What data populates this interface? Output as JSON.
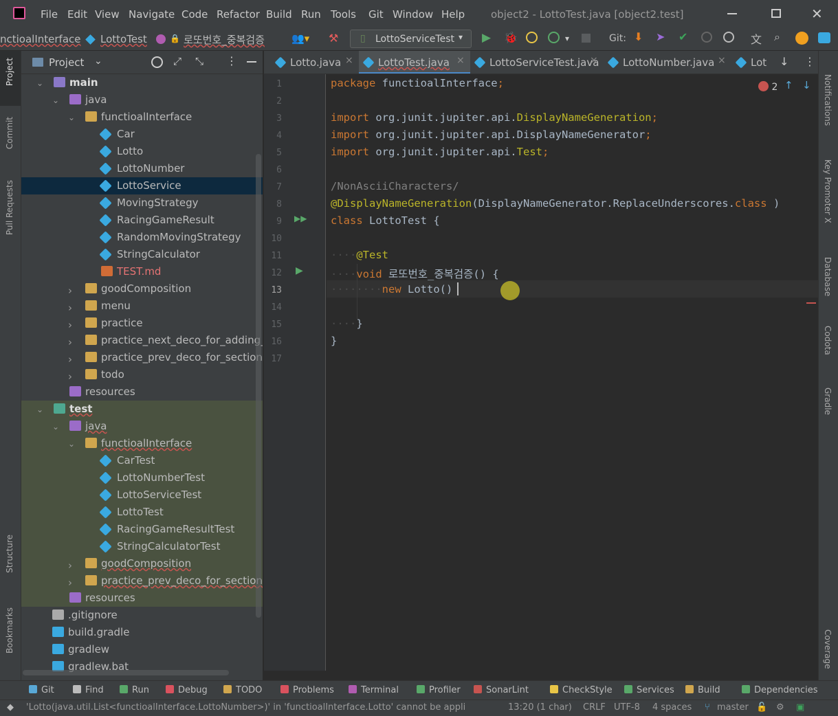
{
  "menu": [
    "File",
    "Edit",
    "View",
    "Navigate",
    "Code",
    "Refactor",
    "Build",
    "Run",
    "Tools",
    "Git",
    "Window",
    "Help"
  ],
  "window_title": "object2 - LottoTest.java [object2.test]",
  "breadcrumb": {
    "part1": "nctioalInterface",
    "sep": "›",
    "part2": "LottoTest",
    "part3": "로또번호_중복검증"
  },
  "run_config": "LottoServiceTest",
  "git_label": "Git:",
  "project_panel": {
    "title": "Project"
  },
  "tree": [
    {
      "label": "main",
      "depth": 0,
      "type": "module",
      "expanded": true,
      "bold": true
    },
    {
      "label": "java",
      "depth": 1,
      "type": "src",
      "expanded": true
    },
    {
      "label": "functioalInterface",
      "depth": 2,
      "type": "folder",
      "expanded": true
    },
    {
      "label": "Car",
      "depth": 3,
      "type": "class"
    },
    {
      "label": "Lotto",
      "depth": 3,
      "type": "class"
    },
    {
      "label": "LottoNumber",
      "depth": 3,
      "type": "class"
    },
    {
      "label": "LottoService",
      "depth": 3,
      "type": "class",
      "selected": true
    },
    {
      "label": "MovingStrategy",
      "depth": 3,
      "type": "interface"
    },
    {
      "label": "RacingGameResult",
      "depth": 3,
      "type": "class"
    },
    {
      "label": "RandomMovingStrategy",
      "depth": 3,
      "type": "class"
    },
    {
      "label": "StringCalculator",
      "depth": 3,
      "type": "class"
    },
    {
      "label": "TEST.md",
      "depth": 3,
      "type": "md",
      "error": true
    },
    {
      "label": "goodComposition",
      "depth": 2,
      "type": "folder",
      "expanded": false
    },
    {
      "label": "menu",
      "depth": 2,
      "type": "folder",
      "expanded": false
    },
    {
      "label": "practice",
      "depth": 2,
      "type": "folder",
      "expanded": false
    },
    {
      "label": "practice_next_deco_for_adding_",
      "depth": 2,
      "type": "folder",
      "expanded": false
    },
    {
      "label": "practice_prev_deco_for_section",
      "depth": 2,
      "type": "folder",
      "expanded": false
    },
    {
      "label": "todo",
      "depth": 2,
      "type": "folder",
      "expanded": false
    },
    {
      "label": "resources",
      "depth": 1,
      "type": "res"
    },
    {
      "label": "test",
      "depth": 0,
      "type": "testmodule",
      "expanded": true,
      "bold": true,
      "test": true
    },
    {
      "label": "java",
      "depth": 1,
      "type": "src",
      "expanded": true,
      "test": true
    },
    {
      "label": "functioalInterface",
      "depth": 2,
      "type": "folder",
      "expanded": true,
      "test": true
    },
    {
      "label": "CarTest",
      "depth": 3,
      "type": "class",
      "test": true
    },
    {
      "label": "LottoNumberTest",
      "depth": 3,
      "type": "class",
      "test": true
    },
    {
      "label": "LottoServiceTest",
      "depth": 3,
      "type": "class",
      "test": true
    },
    {
      "label": "LottoTest",
      "depth": 3,
      "type": "class",
      "test": true
    },
    {
      "label": "RacingGameResultTest",
      "depth": 3,
      "type": "class",
      "test": true
    },
    {
      "label": "StringCalculatorTest",
      "depth": 3,
      "type": "class",
      "test": true
    },
    {
      "label": "goodComposition",
      "depth": 2,
      "type": "folder",
      "expanded": false,
      "test": true
    },
    {
      "label": "practice_prev_deco_for_section",
      "depth": 2,
      "type": "folder",
      "expanded": false,
      "test": true
    },
    {
      "label": "resources",
      "depth": 1,
      "type": "res",
      "test": true
    },
    {
      "label": ".gitignore",
      "depth": 0,
      "type": "file"
    },
    {
      "label": "build.gradle",
      "depth": 0,
      "type": "gradle"
    },
    {
      "label": "gradlew",
      "depth": 0,
      "type": "gradle"
    },
    {
      "label": "gradlew.bat",
      "depth": 0,
      "type": "gradle"
    }
  ],
  "editor_tabs": [
    {
      "label": "Lotto.java",
      "close": "×"
    },
    {
      "label": "LottoTest.java",
      "close": "×",
      "active": true
    },
    {
      "label": "LottoServiceTest.java",
      "close": "×"
    },
    {
      "label": "LottoNumber.java",
      "close": "×"
    },
    {
      "label": "Lot",
      "close": ""
    }
  ],
  "error_count": "2",
  "code_lines": [
    [
      [
        "kw",
        "package"
      ],
      [
        "",
        "functioalInterface"
      ],
      [
        "pun",
        ";"
      ]
    ],
    [],
    [
      [
        "kw",
        "import"
      ],
      [
        "",
        "org.junit.jupiter.api."
      ],
      [
        "ann",
        "DisplayNameGeneration"
      ],
      [
        "pun",
        ";"
      ]
    ],
    [
      [
        "kw",
        "import"
      ],
      [
        "",
        "org.junit.jupiter.api.DisplayNameGenerator"
      ],
      [
        "pun",
        ";"
      ]
    ],
    [
      [
        "kw",
        "import"
      ],
      [
        "",
        "org.junit.jupiter.api."
      ],
      [
        "ann",
        "Test"
      ],
      [
        "pun",
        ";"
      ]
    ],
    [],
    [
      [
        "cm",
        "/NonAsciiCharacters/"
      ]
    ],
    [
      [
        "ann",
        "@DisplayNameGeneration"
      ],
      [
        "",
        "(DisplayNameGenerator.ReplaceUnderscores."
      ],
      [
        "kw",
        "class"
      ],
      [
        "",
        ")"
      ]
    ],
    [
      [
        "kw",
        "class"
      ],
      [
        "",
        "LottoTest {"
      ]
    ],
    [],
    [
      [
        "dot",
        "····"
      ],
      [
        "ann",
        "@Test"
      ]
    ],
    [
      [
        "dot",
        "····"
      ],
      [
        "kw",
        "void"
      ],
      [
        "",
        "로또번호_중복검증() {"
      ]
    ],
    [
      [
        "dot",
        "········"
      ],
      [
        "kw",
        "new"
      ],
      [
        "",
        "Lotto()"
      ]
    ],
    [],
    [
      [
        "dot",
        "····"
      ],
      [
        "",
        "}"
      ]
    ],
    [
      [
        "",
        "}"
      ]
    ],
    []
  ],
  "tool_windows": [
    "Git",
    "Find",
    "Run",
    "Debug",
    "TODO",
    "Problems",
    "Terminal",
    "Profiler",
    "SonarLint",
    "CheckStyle",
    "Services",
    "Build",
    "Dependencies"
  ],
  "left_tabs": [
    "Project",
    "Commit",
    "Pull Requests",
    "Structure",
    "Bookmarks"
  ],
  "right_tabs": [
    "Notifications",
    "Key Promoter X",
    "Database",
    "Codota",
    "Gradle",
    "Coverage"
  ],
  "status": {
    "message": "'Lotto(java.util.List<functioalInterface.LottoNumber>)' in 'functioalInterface.Lotto' cannot be appli",
    "position": "13:20 (1 char)",
    "line_sep": "CRLF",
    "encoding": "UTF-8",
    "indent": "4 spaces",
    "branch": "master"
  },
  "colors": {
    "bg": "#2b2b2b",
    "panel": "#3c3f41",
    "keyword": "#cc7832",
    "annotation": "#bbb529",
    "selected": "#0d293e",
    "test_bg": "#4a5240",
    "error": "#c75450"
  }
}
